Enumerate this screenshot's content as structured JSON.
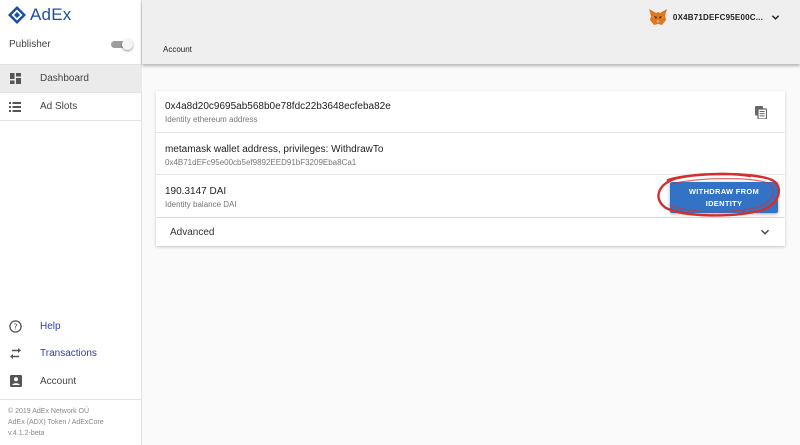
{
  "app": {
    "logo_text": "AdEx",
    "mode_label": "Publisher",
    "mode_toggle_on": true,
    "brand_color": "#1b4ea8",
    "accent_color": "#3273c6"
  },
  "sidebar": {
    "items": [
      {
        "label": "Dashboard",
        "icon": "dashboard-icon",
        "active": true
      },
      {
        "label": "Ad Slots",
        "icon": "list-icon",
        "active": false
      }
    ],
    "bottom_items": [
      {
        "label": "Help",
        "icon": "help-icon"
      },
      {
        "label": "Transactions",
        "icon": "swap-icon"
      },
      {
        "label": "Account",
        "icon": "account-box-icon"
      }
    ],
    "footer": {
      "copyright": "© 2019  AdEx Network OÜ",
      "token_link": "AdEx (ADX) Token",
      "separator": "/",
      "core_link": "AdExCore",
      "version": "v.4.1.2-beta"
    }
  },
  "topbar": {
    "title": "Account",
    "account_address": "0X4B71DEFC95E00C...",
    "wallet_icon": "metamask-fox-icon"
  },
  "identity": {
    "address": "0x4a8d20c9695ab568b0e78fdc22b3648ecfeba82e",
    "address_label": "Identity ethereum address",
    "wallet_title": "metamask wallet address, privileges: WithdrawTo",
    "wallet_address": "0x4B71dEFc95e00cb5ef9892EED91bF3209Eba8Ca1",
    "balance": "190.3147 DAI",
    "balance_label": "Identity balance DAI",
    "withdraw_label": "WITHDRAW FROM IDENTITY",
    "annotation_color": "#d32f2f"
  },
  "advanced": {
    "label": "Advanced"
  }
}
